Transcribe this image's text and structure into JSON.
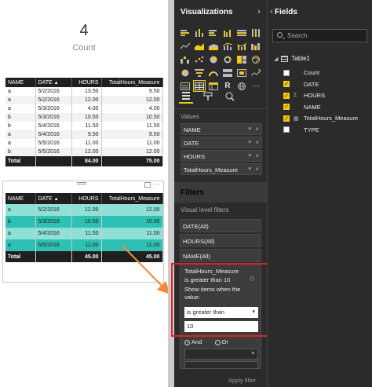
{
  "card": {
    "value": "4",
    "label": "Count"
  },
  "table1": {
    "headers": [
      "NAME",
      "DATE",
      "HOURS",
      "TotalHours_Measure"
    ],
    "rows": [
      [
        "a",
        "5/2/2016",
        "13.50",
        "9.50"
      ],
      [
        "a",
        "5/2/2016",
        "12.00",
        "12.00"
      ],
      [
        "a",
        "5/3/2016",
        "4.00",
        "4.00"
      ],
      [
        "b",
        "5/3/2016",
        "10.50",
        "10.50"
      ],
      [
        "b",
        "5/4/2016",
        "11.50",
        "11.50"
      ],
      [
        "a",
        "5/4/2016",
        "9.50",
        "9.50"
      ],
      [
        "a",
        "5/5/2016",
        "11.00",
        "11.00"
      ],
      [
        "b",
        "5/5/2016",
        "12.00",
        "12.00"
      ]
    ],
    "total": [
      "Total",
      "",
      "84.00",
      "75.00"
    ]
  },
  "table2": {
    "headers": [
      "NAME",
      "DATE",
      "HOURS",
      "TotalHours_Measure"
    ],
    "rows": [
      [
        "a",
        "5/2/2016",
        "12.00",
        "12.00"
      ],
      [
        "b",
        "5/3/2016",
        "10.50",
        "10.50"
      ],
      [
        "a",
        "5/4/2016",
        "11.50",
        "11.50"
      ],
      [
        "a",
        "5/5/2016",
        "11.00",
        "11.00"
      ]
    ],
    "total": [
      "Total",
      "",
      "45.00",
      "45.00"
    ]
  },
  "viz_pane": {
    "title": "Visualizations",
    "values_label": "Values",
    "value_wells": [
      "NAME",
      "DATE",
      "HOURS",
      "TotalHours_Measure"
    ]
  },
  "filters": {
    "title": "Filters",
    "level_label": "Visual level filters",
    "items": [
      "DATE(All)",
      "HOURS(All)",
      "NAME(All)"
    ],
    "expanded": {
      "field": "TotalHours_Measure",
      "summary": "is greater than 10",
      "instruction": "Show items when the value:",
      "operator": "is greater than",
      "value": "10",
      "and_label": "And",
      "or_label": "Or",
      "apply_label": "Apply filter"
    }
  },
  "fields_pane": {
    "title": "Fields",
    "search_placeholder": "Search",
    "table_name": "Table1",
    "fields": [
      {
        "name": "Count",
        "checked": false,
        "type": ""
      },
      {
        "name": "DATE",
        "checked": true,
        "type": ""
      },
      {
        "name": "HOURS",
        "checked": true,
        "type": "Σ"
      },
      {
        "name": "NAME",
        "checked": true,
        "type": ""
      },
      {
        "name": "TotalHours_Measure",
        "checked": true,
        "type": "▦"
      },
      {
        "name": "TYPE",
        "checked": false,
        "type": ""
      }
    ]
  },
  "colors": {
    "accent": "#f2c811",
    "highlight": "#d9232e",
    "arrow": "#f08a3c",
    "teal_dark": "#2ec0b2",
    "teal_light": "#8fe0d6"
  }
}
